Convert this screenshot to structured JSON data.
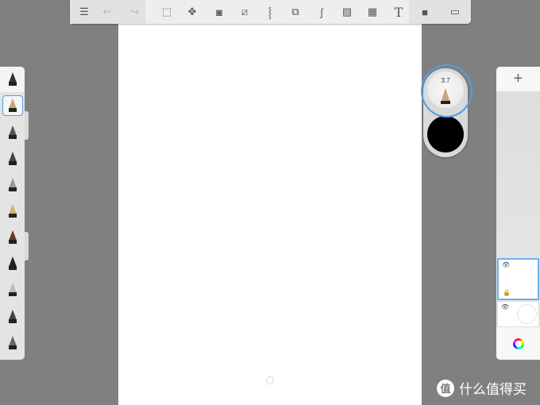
{
  "toolbar": {
    "items": [
      {
        "icon": "list-icon",
        "glyph": "☰"
      },
      {
        "icon": "undo-icon",
        "glyph": "↩"
      },
      {
        "icon": "redo-icon",
        "glyph": "↪"
      },
      {
        "icon": "selection-icon",
        "glyph": "⬚"
      },
      {
        "icon": "transform-icon",
        "glyph": "✥"
      },
      {
        "icon": "fill-icon",
        "glyph": "◙"
      },
      {
        "icon": "ruler-icon",
        "glyph": "⧄"
      },
      {
        "icon": "symmetry-icon",
        "glyph": "⸾"
      },
      {
        "icon": "shapes-icon",
        "glyph": "⧉"
      },
      {
        "icon": "curve-icon",
        "glyph": "∫"
      },
      {
        "icon": "image-icon",
        "glyph": "▨"
      },
      {
        "icon": "perspective-icon",
        "glyph": "▦"
      },
      {
        "icon": "text-icon",
        "glyph": "T"
      },
      {
        "icon": "record-icon",
        "glyph": "■"
      },
      {
        "icon": "fullscreen-icon",
        "glyph": "▭"
      }
    ]
  },
  "puck": {
    "brush_size": "3.7",
    "color": "#000000"
  },
  "layers": {
    "add_label": "+"
  },
  "watermark": {
    "logo": "值",
    "text": "什么值得买"
  }
}
